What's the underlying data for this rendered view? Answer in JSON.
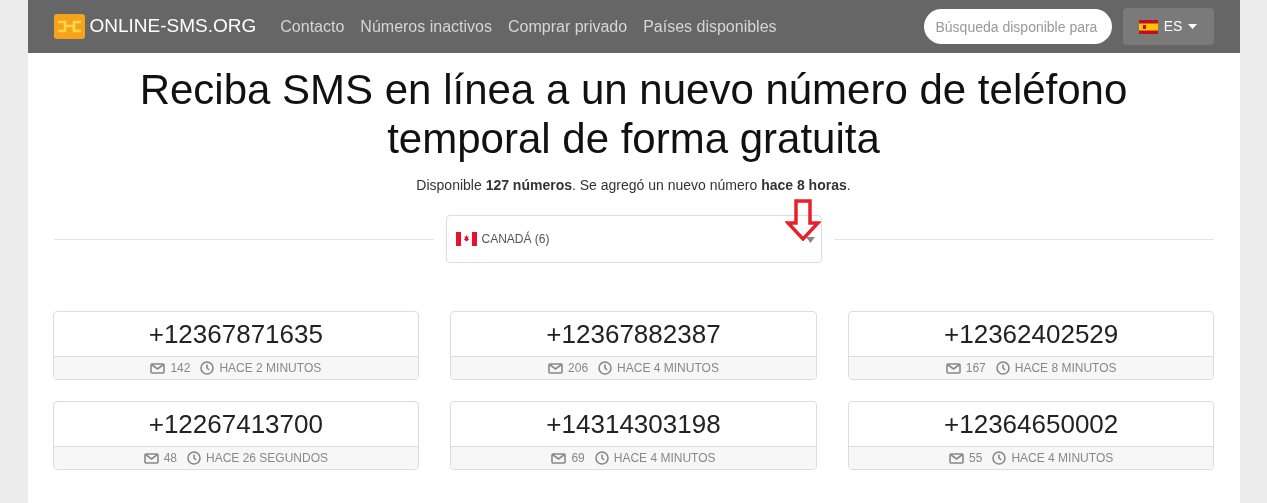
{
  "navbar": {
    "brand": "ONLINE-SMS.ORG",
    "links": [
      "Contacto",
      "Números inactivos",
      "Comprar privado",
      "Países disponibles"
    ],
    "search": {
      "placeholder": "Búsqueda disponible para"
    },
    "language": "ES"
  },
  "heading": "Reciba SMS en línea a un nuevo número de teléfono temporal de forma gratuita",
  "subtitle": "Disponible **127 números**. Se agregó un nuevo número **hace 8 horas**.",
  "country_select": "CANADÁ (6)",
  "numbers": [
    {
      "number": "+12367871635",
      "messages": "142",
      "time": "HACE 2 MINUTOS"
    },
    {
      "number": "+12367882387",
      "messages": "206",
      "time": "HACE 4 MINUTOS"
    },
    {
      "number": "+12362402529",
      "messages": "167",
      "time": "HACE 8 MINUTOS"
    },
    {
      "number": "+12267413700",
      "messages": "48",
      "time": "HACE 26 SEGUNDOS"
    },
    {
      "number": "+14314303198",
      "messages": "69",
      "time": "HACE 4 MINUTOS"
    },
    {
      "number": "+12364650002",
      "messages": "55",
      "time": "HACE 4 MINUTOS"
    }
  ]
}
